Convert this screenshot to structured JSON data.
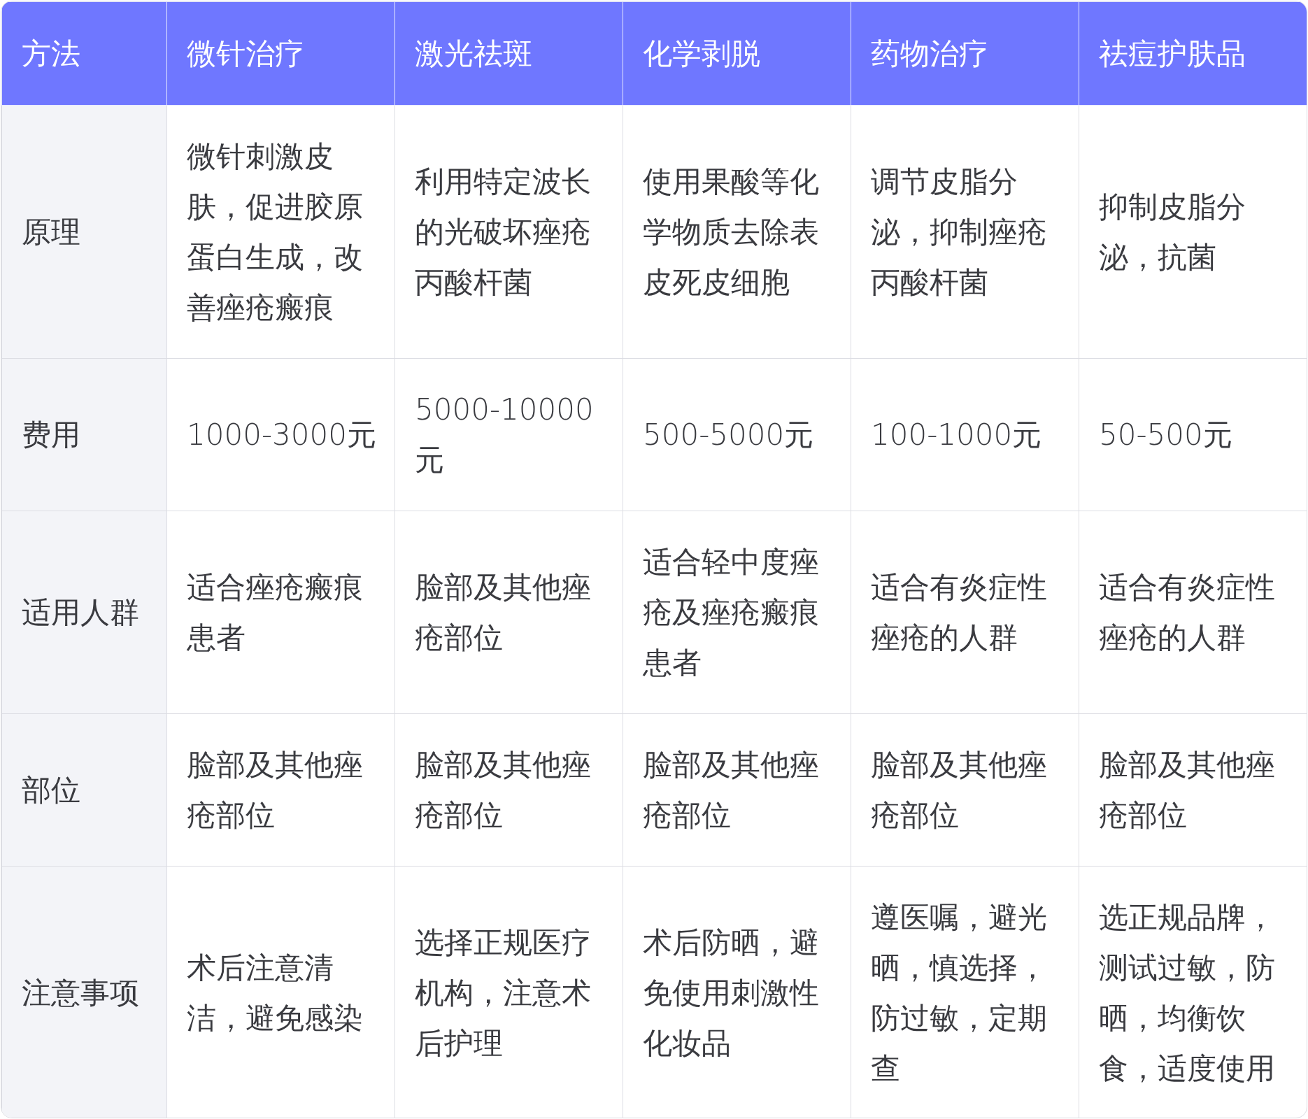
{
  "table": {
    "columns": [
      "方法",
      "微针治疗",
      "激光祛斑",
      "化学剥脱",
      "药物治疗",
      "祛痘护肤品"
    ],
    "rows": [
      {
        "cells": [
          "原理",
          "微针刺激皮肤，促进胶原蛋白生成，改善痤疮瘢痕",
          "利用特定波长的光破坏痤疮丙酸杆菌",
          "使用果酸等化学物质去除表皮死皮细胞",
          "调节皮脂分泌，抑制痤疮丙酸杆菌",
          "抑制皮脂分泌，抗菌"
        ]
      },
      {
        "cells": [
          "费用",
          "1000-3000元",
          "5000-10000元",
          "500-5000元",
          "100-1000元",
          "50-500元"
        ]
      },
      {
        "cells": [
          "适用人群",
          "适合痤疮瘢痕患者",
          "脸部及其他痤疮部位",
          "适合轻中度痤疮及痤疮瘢痕患者",
          "适合有炎症性痤疮的人群",
          "适合有炎症性痤疮的人群"
        ]
      },
      {
        "cells": [
          "部位",
          "脸部及其他痤疮部位",
          "脸部及其他痤疮部位",
          "脸部及其他痤疮部位",
          "脸部及其他痤疮部位",
          "脸部及其他痤疮部位"
        ]
      },
      {
        "cells": [
          "注意事项",
          "术后注意清洁，避免感染",
          "选择正规医疗机构，注意术后护理",
          "术后防晒，避免使用刺激性化妆品",
          "遵医嘱，避光晒，慎选择，防过敏，定期查",
          "选正规品牌，测试过敏，防晒，均衡饮食，适度使用"
        ]
      }
    ]
  }
}
